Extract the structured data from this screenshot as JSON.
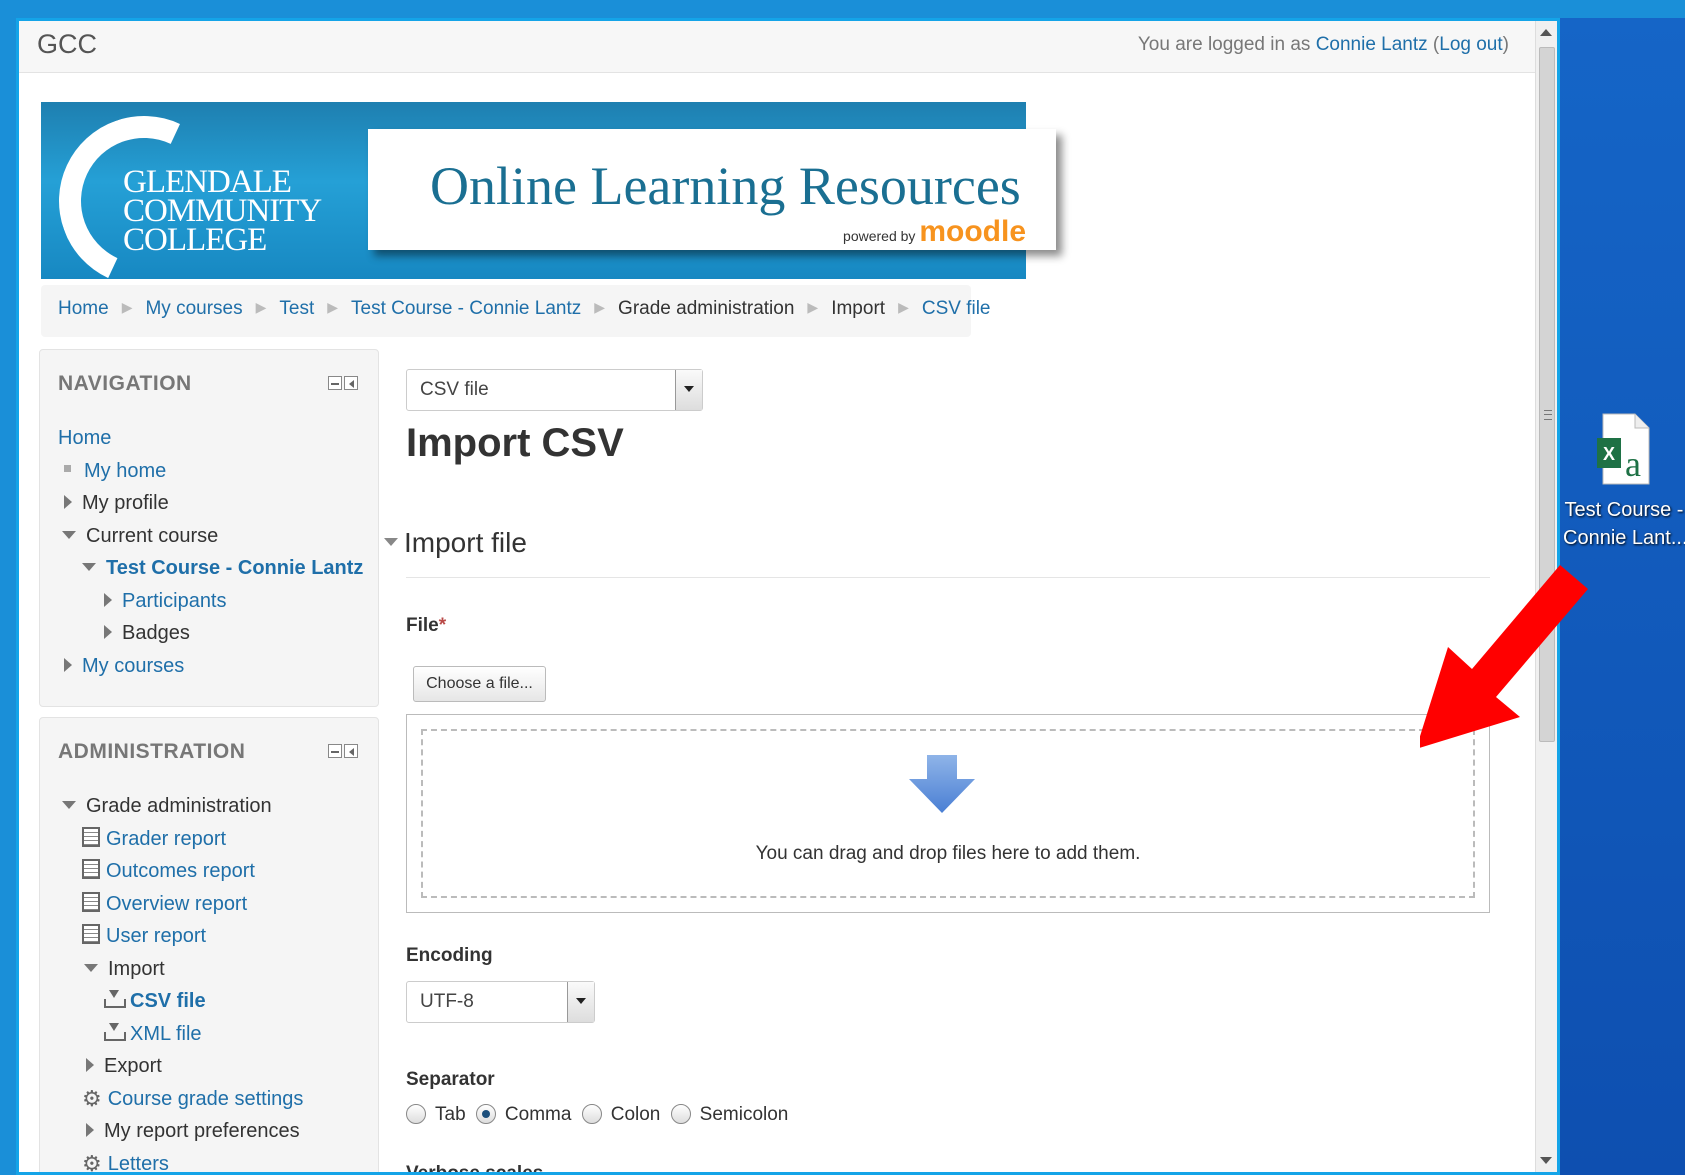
{
  "header": {
    "site_name": "GCC",
    "login_prefix": "You are logged in as ",
    "user_name": "Connie Lantz",
    "logout_open": " (",
    "logout_label": "Log out",
    "logout_close": ")"
  },
  "banner": {
    "college_line1": "GLENDALE",
    "college_line2": "COMMUNITY",
    "college_line3": "COLLEGE",
    "title": "Online Learning Resources",
    "powered_by": "powered by ",
    "moodle": "moodle"
  },
  "breadcrumb": [
    "Home",
    "My courses",
    "Test",
    "Test Course - Connie Lantz",
    "Grade administration",
    "Import",
    "CSV file"
  ],
  "navigation": {
    "title": "NAVIGATION",
    "home": "Home",
    "my_home": "My home",
    "my_profile": "My profile",
    "current_course": "Current course",
    "course_name": "Test Course - Connie Lantz",
    "participants": "Participants",
    "badges": "Badges",
    "my_courses": "My courses"
  },
  "administration": {
    "title": "ADMINISTRATION",
    "grade_admin": "Grade administration",
    "grader_report": "Grader report",
    "outcomes_report": "Outcomes report",
    "overview_report": "Overview report",
    "user_report": "User report",
    "import": "Import",
    "csv_file": "CSV file",
    "xml_file": "XML file",
    "export": "Export",
    "course_grade_settings": "Course grade settings",
    "my_report_prefs": "My report preferences",
    "letters": "Letters"
  },
  "main": {
    "jump_select": "CSV file",
    "page_title": "Import CSV",
    "section_title": "Import file",
    "file_label": "File",
    "required_mark": "*",
    "choose_button": "Choose a file...",
    "drop_text": "You can drag and drop files here to add them.",
    "encoding_label": "Encoding",
    "encoding_value": "UTF-8",
    "separator_label": "Separator",
    "separator_options": [
      "Tab",
      "Comma",
      "Colon",
      "Semicolon"
    ],
    "separator_selected": "Comma",
    "verbose_label": "Verbose scales"
  },
  "desktop": {
    "file_line1": "Test Course -",
    "file_line2": "Connie Lant..."
  },
  "colors": {
    "link": "#1f6fa9",
    "annotation_arrow": "#ff0000",
    "desktop": "#1565c7"
  }
}
